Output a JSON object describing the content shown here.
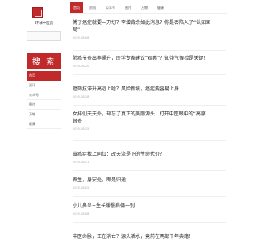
{
  "sidebar": {
    "logo_text": "环球中医药",
    "search_placeholder": "",
    "search_button": "搜 索",
    "nav_items": [
      "首页",
      "资讯",
      "公众号",
      "图片",
      "万物",
      "健康"
    ]
  },
  "topnav": {
    "tabs": [
      "首页",
      "资讯",
      "公众号",
      "图片",
      "万物",
      "健康"
    ]
  },
  "articles": [
    {
      "title_lines": [
        "傅了癌症就要一刀切？李增背余如此消息？你是否陷入了“认知困",
        "局”"
      ],
      "date": "2025-08-06"
    },
    {
      "title_lines": [
        "肺癌节查出率飙升，医学专家建议“观察”？知带气候检是关键！"
      ],
      "date": "2025-08-20"
    },
    {
      "title_lines": [
        "癌筛抗滞升高远上啥？风险新境，癌症要容易上身"
      ],
      "date": "2025-08-18"
    },
    {
      "title_lines": [
        "女排们天天外，却忘了真正的美丽源头...打开中医眼中的“高原",
        "督查"
      ],
      "date": "2025-08-15"
    },
    {
      "title_lines": [
        "当癌症找上同红：改天流是下的生命代价？"
      ],
      "date": "2025-08-11"
    },
    {
      "title_lines": [
        "养生，身安处，即是归途"
      ],
      "date": "2025-08-02"
    },
    {
      "title_lines": [
        "小儿鼻炎+生长缓慢肩俩一别"
      ],
      "date": "2025-08-08"
    },
    {
      "title_lines": [
        "中医命脉，正在消亡？源头活水，竟前在两部千年典籍！"
      ],
      "date": ""
    }
  ],
  "colors": {
    "brand_red": "#c12a2a",
    "rule_gray": "#eeeeee"
  }
}
